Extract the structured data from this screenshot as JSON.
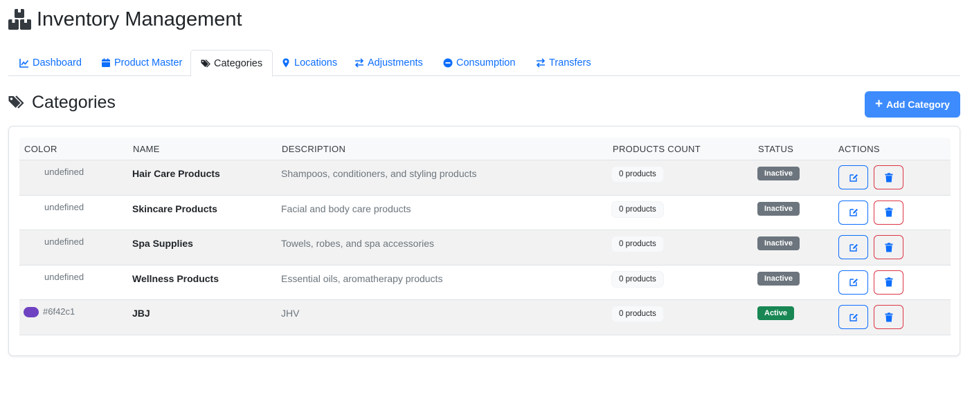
{
  "app": {
    "title": "Inventory Management"
  },
  "tabs": [
    {
      "label": "Dashboard",
      "icon": "chart-line-icon",
      "active": false
    },
    {
      "label": "Product Master",
      "icon": "calendar-icon",
      "active": false
    },
    {
      "label": "Categories",
      "icon": "tags-icon",
      "active": true
    },
    {
      "label": "Locations",
      "icon": "map-pin-icon",
      "active": false
    },
    {
      "label": "Adjustments",
      "icon": "exchange-icon",
      "active": false
    },
    {
      "label": "Consumption",
      "icon": "minus-circle-icon",
      "active": false
    },
    {
      "label": "Transfers",
      "icon": "exchange-icon",
      "active": false
    }
  ],
  "page": {
    "title": "Categories",
    "add_button": "Add Category"
  },
  "table": {
    "headers": {
      "color": "COLOR",
      "name": "NAME",
      "description": "DESCRIPTION",
      "products_count": "PRODUCTS COUNT",
      "status": "STATUS",
      "actions": "ACTIONS"
    },
    "rows": [
      {
        "color_text": "undefined",
        "swatch": "",
        "name": "Hair Care Products",
        "description": "Shampoos, conditioners, and styling products",
        "count": "0 products",
        "status": "Inactive"
      },
      {
        "color_text": "undefined",
        "swatch": "",
        "name": "Skincare Products",
        "description": "Facial and body care products",
        "count": "0 products",
        "status": "Inactive"
      },
      {
        "color_text": "undefined",
        "swatch": "",
        "name": "Spa Supplies",
        "description": "Towels, robes, and spa accessories",
        "count": "0 products",
        "status": "Inactive"
      },
      {
        "color_text": "undefined",
        "swatch": "",
        "name": "Wellness Products",
        "description": "Essential oils, aromatherapy products",
        "count": "0 products",
        "status": "Inactive"
      },
      {
        "color_text": "#6f42c1",
        "swatch": "#6f42c1",
        "name": "JBJ",
        "description": "JHV",
        "count": "0 products",
        "status": "Active"
      }
    ]
  },
  "colors": {
    "primary": "#0d6efd",
    "add_button_bg": "#3d8bfd",
    "inactive": "#6c757d",
    "active": "#198754",
    "danger": "#dc3545"
  }
}
